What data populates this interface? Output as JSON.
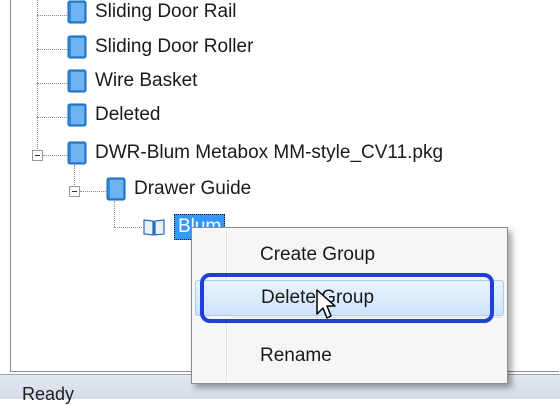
{
  "tree": {
    "items": [
      {
        "label": "Sliding Door Rail"
      },
      {
        "label": "Sliding Door Roller"
      },
      {
        "label": "Wire Basket"
      },
      {
        "label": "Deleted"
      },
      {
        "label": "DWR-Blum Metabox MM-style_CV11.pkg"
      },
      {
        "label": "Drawer Guide"
      },
      {
        "label": "Blum"
      }
    ]
  },
  "context_menu": {
    "items": [
      {
        "label": "Create Group"
      },
      {
        "label": "Delete Group"
      },
      {
        "label": "Rename"
      }
    ]
  },
  "status_bar": {
    "text": "Ready"
  },
  "colors": {
    "book_icon": "#2f8be0",
    "selection": "#3399ff",
    "highlight_ring": "#1f3fd6"
  },
  "icons": {
    "book": "blue-book-icon",
    "open_book": "open-book-icon",
    "cursor": "mouse-pointer-icon"
  }
}
